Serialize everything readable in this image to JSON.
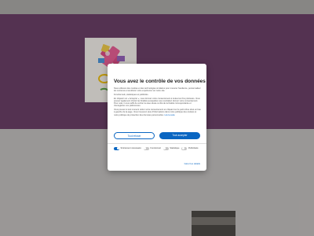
{
  "consent": {
    "title": "Vous avez le contrôle de vos données",
    "paragraphs": [
      "Nous utilisons des cookies et des technologies similaires pour mesurer l'audience, personnaliser les contenus et améliorer votre expérience sur notre site.",
      "Fonctionnels, statistiques et publicités.",
      "En cliquant sur « Accepter », vous donnez votre consentement à toutes les fins précisées. Vous pouvez également choisir les finalités auxquelles vous souhaitez donner votre consentement. Pour cela, il vous suffit de cocher la case située à côté de la finalité correspondante et d'enregistrer vos préférences.",
      "Vous pouvez à tout moment retirer votre consentement en cliquant sur le petit icône situé en bas à gauche de la page. Vous trouverez plus d'informations dans notre politique des cookies et notre politique de protection des données personnelles."
    ],
    "more_link": "Lire la suite",
    "refuse_label": "Tout refuser",
    "accept_label": "Tout accepter",
    "toggles": [
      {
        "label": "Strictement nécessaire",
        "on": true
      },
      {
        "label": "Fonctionnel",
        "on": false
      },
      {
        "label": "Statistique",
        "on": false
      },
      {
        "label": "Publicitaire",
        "on": false
      }
    ],
    "settings_link": "Gérer les détails",
    "accent_color": "#0a66c2"
  },
  "background": {
    "band_color": "#5c2f58",
    "logo_icon": "flower-logo-icon"
  }
}
